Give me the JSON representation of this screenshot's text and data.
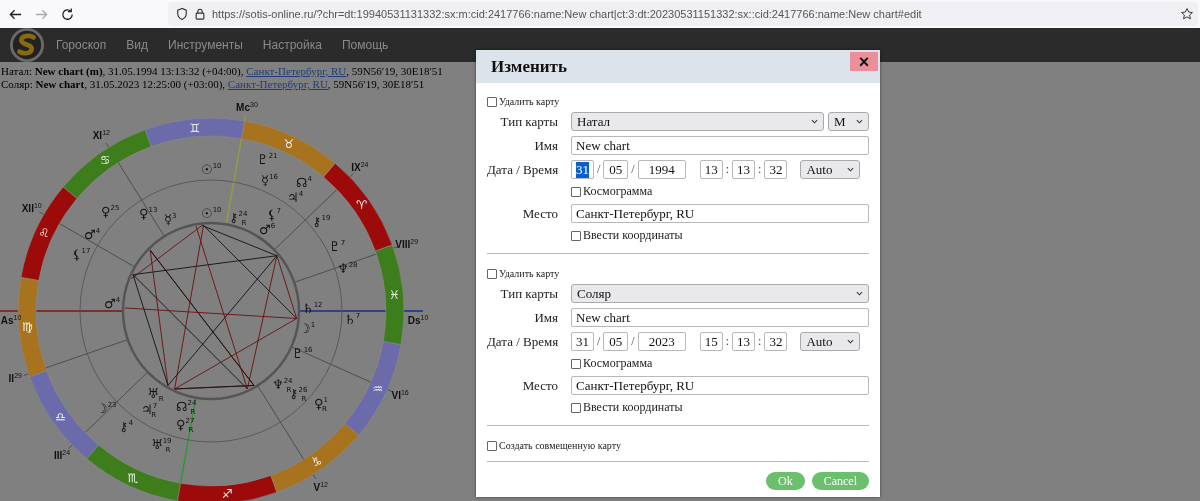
{
  "browser": {
    "url": "https://sotis-online.ru/?chr=dt:19940531131332:sx:m:cid:2417766:name:New chart|ct:3:dt:20230531151332:sx::cid:2417766:name:New chart#edit"
  },
  "menu": {
    "items": [
      "Гороскоп",
      "Вид",
      "Инструменты",
      "Настройка",
      "Помощь"
    ]
  },
  "chart_info": [
    {
      "text_before": "Натал: **New chart (m)**, 31.05.1994 13:13:32 (+04:00), ",
      "link": "Санкт-Петербург, RU",
      "text_after": ", 59N56′19, 30E18′51"
    },
    {
      "text_before": "Соляр: **New chart**, 31.05.2023 12:25:00 (+03:00), ",
      "link": "Санкт-Петербург, RU",
      "text_after": ", 59N56′19, 30E18′51"
    }
  ],
  "wheel": {
    "zodiac": [
      {
        "glyph": "♈︎",
        "color": "#9c0a0a"
      },
      {
        "glyph": "♉︎",
        "color": "#a8731f"
      },
      {
        "glyph": "♊︎",
        "color": "#6b6bab"
      },
      {
        "glyph": "♋︎",
        "color": "#3e7d1c"
      },
      {
        "glyph": "♌︎",
        "color": "#9c0a0a"
      },
      {
        "glyph": "♍︎",
        "color": "#a8731f"
      },
      {
        "glyph": "♎︎",
        "color": "#6b6bab"
      },
      {
        "glyph": "♏︎",
        "color": "#3e7d1c"
      },
      {
        "glyph": "♐︎",
        "color": "#9c0a0a"
      },
      {
        "glyph": "♑︎",
        "color": "#a8731f"
      },
      {
        "glyph": "♒︎",
        "color": "#6b6bab"
      },
      {
        "glyph": "♓︎",
        "color": "#3e7d1c"
      }
    ],
    "cusps": [
      {
        "label": "As",
        "degree": "10"
      },
      {
        "label": "II",
        "degree": "29"
      },
      {
        "label": "III",
        "degree": "24"
      },
      {
        "label": "V",
        "degree": "12"
      },
      {
        "label": "VI",
        "degree": "16"
      },
      {
        "label": "Ds",
        "degree": "10"
      },
      {
        "label": "VIII",
        "degree": "29"
      },
      {
        "label": "IX",
        "degree": "24"
      },
      {
        "label": "Mc",
        "degree": "30"
      },
      {
        "label": "XI",
        "degree": "12"
      },
      {
        "label": "XII",
        "degree": "10"
      }
    ],
    "planets": [
      {
        "glyph": "☉",
        "degree": "10"
      },
      {
        "glyph": "♇",
        "degree": "21"
      },
      {
        "glyph": "☿",
        "degree": "16"
      },
      {
        "glyph": "☊",
        "degree": "4"
      },
      {
        "glyph": "♃",
        "degree": "4"
      },
      {
        "glyph": "⚷",
        "degree": "19"
      },
      {
        "glyph": "♇",
        "degree": "7"
      },
      {
        "glyph": "♆",
        "degree": "28"
      },
      {
        "glyph": "♄",
        "degree": "7"
      },
      {
        "glyph": "♀",
        "degree": "1",
        "retro": "R"
      },
      {
        "glyph": "♅",
        "degree": "19",
        "retro": "R"
      },
      {
        "glyph": "♀",
        "degree": "27",
        "retro": "R"
      },
      {
        "glyph": "⚷",
        "degree": "4"
      },
      {
        "glyph": "☽",
        "degree": "23"
      },
      {
        "glyph": "⚸",
        "degree": "17"
      },
      {
        "glyph": "♂",
        "degree": "4"
      },
      {
        "glyph": "♀",
        "degree": "25"
      },
      {
        "glyph": "♀",
        "degree": "13"
      },
      {
        "glyph": "☿",
        "degree": "3"
      },
      {
        "glyph": "☉",
        "degree": "10"
      },
      {
        "glyph": "⚷",
        "degree": "24",
        "retro": "R"
      },
      {
        "glyph": "⚸",
        "degree": "7"
      },
      {
        "glyph": "♂",
        "degree": "6"
      },
      {
        "glyph": "♂",
        "degree": "4"
      },
      {
        "glyph": "♄",
        "degree": "12"
      },
      {
        "glyph": "☽",
        "degree": "1"
      },
      {
        "glyph": "♇",
        "degree": "16"
      },
      {
        "glyph": "♆",
        "degree": "24",
        "retro": "R"
      },
      {
        "glyph": "⚷",
        "degree": "26",
        "retro": "R"
      },
      {
        "glyph": "♅",
        "retro": "R"
      },
      {
        "glyph": "♃",
        "degree": "7",
        "retro": "R"
      },
      {
        "glyph": "☊",
        "degree": "24",
        "retro": "R"
      }
    ]
  },
  "dialog": {
    "title": "Изменить",
    "close": "×",
    "sections": [
      {
        "delete": {
          "label": "Удалить карту",
          "checked": false
        },
        "type_label": "Тип карты",
        "type": "Натал",
        "gender": "М",
        "name_label": "Имя",
        "name": "New chart",
        "datetime_label": "Дата / Время",
        "date": [
          {
            "value": "31",
            "text_selected": true
          },
          {
            "value": "05",
            "text_selected": false
          },
          {
            "value": "1994",
            "text_selected": false
          }
        ],
        "date_separators": [
          "/",
          "/"
        ],
        "time": [
          {
            "value": "13",
            "text_selected": false
          },
          {
            "value": "13",
            "text_selected": false
          },
          {
            "value": "32",
            "text_selected": false
          }
        ],
        "time_separators": [
          ":",
          ":"
        ],
        "timezone": "Auto",
        "cosmogram": {
          "label": "Космограмма",
          "checked": false
        },
        "place_label": "Место",
        "place": "Санкт-Петербург, RU",
        "coords": {
          "label": "Ввести координаты",
          "checked": false
        }
      },
      {
        "delete": {
          "label": "Удалить карту",
          "checked": false
        },
        "type_label": "Тип карты",
        "type": "Соляр",
        "name_label": "Имя",
        "name": "New chart",
        "datetime_label": "Дата / Время",
        "date": [
          {
            "value": "31",
            "text_selected": false
          },
          {
            "value": "05",
            "text_selected": false
          },
          {
            "value": "2023",
            "text_selected": false
          }
        ],
        "date_separators": [
          "/",
          "/"
        ],
        "time": [
          {
            "value": "15",
            "text_selected": false
          },
          {
            "value": "13",
            "text_selected": false
          },
          {
            "value": "32",
            "text_selected": false
          }
        ],
        "time_separators": [
          ":",
          ":"
        ],
        "timezone": "Auto",
        "cosmogram": {
          "label": "Космограмма",
          "checked": false
        },
        "place_label": "Место",
        "place": "Санкт-Петербург, RU",
        "coords": {
          "label": "Ввести координаты",
          "checked": false
        }
      }
    ],
    "combined": {
      "label": "Создать совмещенную карту",
      "checked": false
    },
    "buttons": [
      {
        "label": "Ok"
      },
      {
        "label": "Cancel"
      }
    ]
  }
}
